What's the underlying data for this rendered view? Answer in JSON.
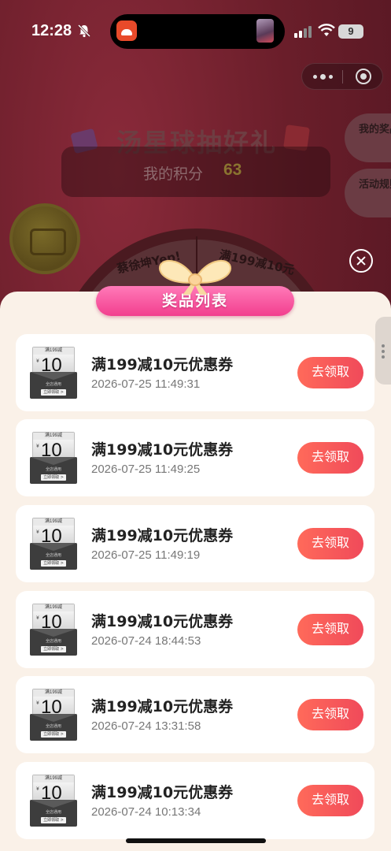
{
  "status_bar": {
    "time": "12:28",
    "battery": "9",
    "icons": [
      "bell-off-icon",
      "app-icon",
      "now-playing-art",
      "signal-icon",
      "wifi-icon",
      "battery-icon"
    ]
  },
  "capsule": {
    "icons": [
      "more-dots-icon",
      "close-circle-icon"
    ]
  },
  "hero": {
    "title": "汤星球抽好礼",
    "points_label": "我的积分",
    "points_value": "63"
  },
  "side_buttons": {
    "my_prizes": "我的奖品",
    "rules": "活动规则"
  },
  "wheel": {
    "segment_left": "蔡徐坤Yep!",
    "segment_right": "满199减10元"
  },
  "sheet": {
    "title": "奖品列表",
    "claim_label": "去领取",
    "coupon": {
      "head": "满199减",
      "value": "10",
      "currency": "¥",
      "sub": "全店通用",
      "cta": "立即领取 >"
    },
    "prizes": [
      {
        "name": "满199减10元优惠券",
        "time": "2026-07-25 11:49:31"
      },
      {
        "name": "满199减10元优惠券",
        "time": "2026-07-25 11:49:25"
      },
      {
        "name": "满199减10元优惠券",
        "time": "2026-07-25 11:49:19"
      },
      {
        "name": "满199减10元优惠券",
        "time": "2026-07-24 18:44:53"
      },
      {
        "name": "满199减10元优惠券",
        "time": "2026-07-24 13:31:58"
      },
      {
        "name": "满199减10元优惠券",
        "time": "2026-07-24 10:13:34"
      }
    ]
  },
  "colors": {
    "accent_pink": "#f23e8e",
    "claim_button": "#f04a5a",
    "sheet_bg": "#faf1e8"
  }
}
